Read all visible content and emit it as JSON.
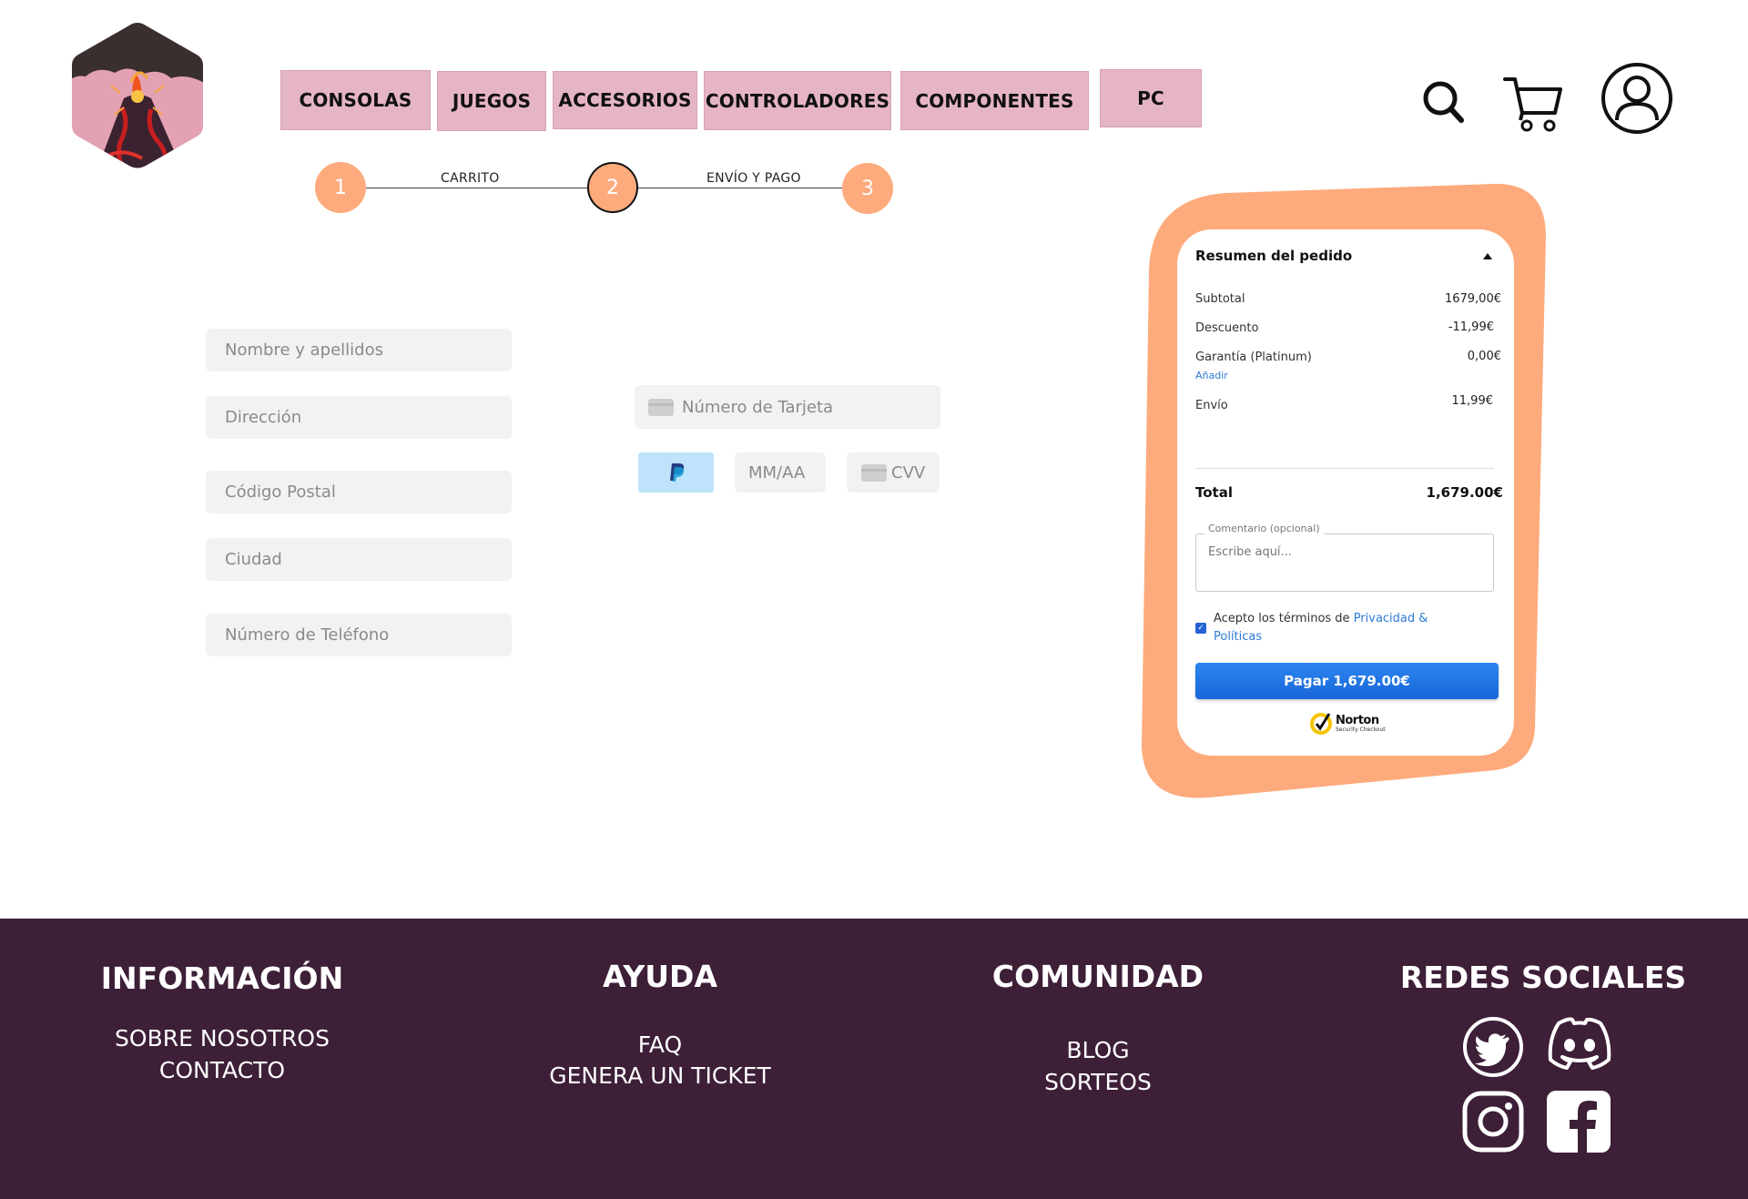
{
  "nav": {
    "items": [
      {
        "label": "CONSOLAS"
      },
      {
        "label": "JUEGOS"
      },
      {
        "label": "ACCESORIOS"
      },
      {
        "label": "CONTROLADORES"
      },
      {
        "label": "COMPONENTES"
      },
      {
        "label": "PC"
      }
    ],
    "icons": [
      "search-icon",
      "cart-icon",
      "user-icon"
    ]
  },
  "stepper": {
    "steps": [
      {
        "number": "1"
      },
      {
        "number": "2"
      },
      {
        "number": "3"
      }
    ],
    "labels": [
      "CARRITO",
      "ENVÍO Y PAGO"
    ],
    "active_step": 2
  },
  "shipping_form": {
    "name_placeholder": "Nombre y apellidos",
    "address_placeholder": "Dirección",
    "postal_placeholder": "Código Postal",
    "city_placeholder": "Ciudad",
    "phone_placeholder": "Número de Teléfono"
  },
  "payment_form": {
    "card_number_placeholder": "Número de Tarjeta",
    "expiry_placeholder": "MM/AA",
    "cvv_placeholder": "CVV"
  },
  "summary": {
    "title": "Resumen del pedido",
    "rows": [
      {
        "label": "Subtotal",
        "value": "1679,00€"
      },
      {
        "label": "Descuento",
        "value": "-11,99€"
      },
      {
        "label": "Garantía (Platinum)",
        "value": "0,00€"
      },
      {
        "label": "Envío",
        "value": "11,99€"
      }
    ],
    "add_link": "Añadir",
    "total_label": "Total",
    "total_value": "1,679.00€",
    "comment_label": "Comentario (opcional)",
    "comment_placeholder": "Escribe aquí...",
    "terms_prefix": "Acepto los términos de ",
    "terms_link": "Privacidad & Políticas",
    "terms_checked": true,
    "pay_button": "Pagar 1,679.00€",
    "norton_name": "Norton",
    "norton_sub": "Security Checkout"
  },
  "footer": {
    "info": {
      "title": "INFORMACIÓN",
      "links": [
        "SOBRE NOSOTROS",
        "CONTACTO"
      ]
    },
    "help": {
      "title": "AYUDA",
      "links": [
        "FAQ",
        "GENERA UN TICKET"
      ]
    },
    "community": {
      "title": "COMUNIDAD",
      "links": [
        "BLOG",
        "SORTEOS"
      ]
    },
    "social": {
      "title": "REDES SOCIALES",
      "icons": [
        "twitter-icon",
        "discord-icon",
        "instagram-icon",
        "facebook-icon"
      ]
    }
  },
  "colors": {
    "nav_pink": "#e6b5c4",
    "accent_orange": "#fdab7d",
    "footer_bg": "#3d1f38",
    "pay_blue": "#1f74e3",
    "link_blue": "#2f7ad6"
  }
}
